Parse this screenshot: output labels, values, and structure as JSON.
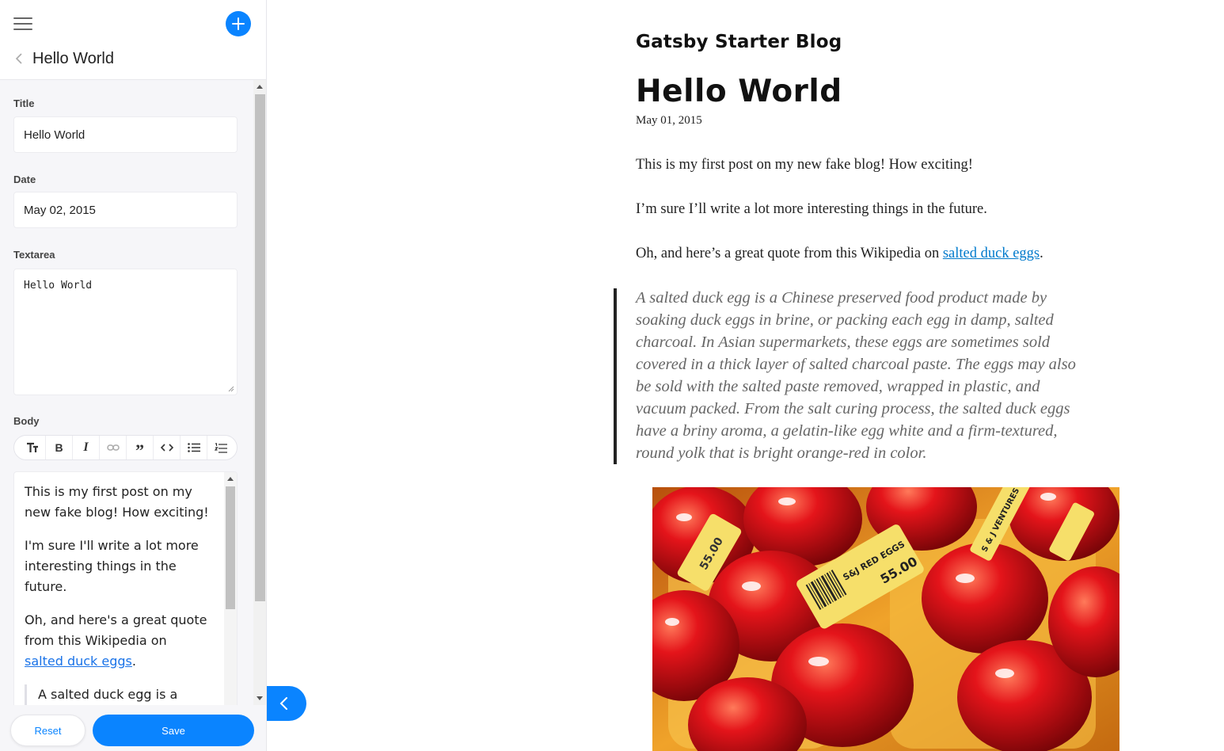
{
  "sidebar": {
    "doc_title": "Hello World",
    "fields": {
      "title_label": "Title",
      "title_value": "Hello World",
      "date_label": "Date",
      "date_value": "May 02, 2015",
      "textarea_label": "Textarea",
      "textarea_value": "Hello World",
      "body_label": "Body"
    },
    "toolbar_icons": [
      "text-size-icon",
      "bold-icon",
      "italic-icon",
      "link-icon",
      "quote-icon",
      "code-icon",
      "bullet-list-icon",
      "numbered-list-icon"
    ],
    "body": {
      "p1": "This is my first post on my new fake blog! How exciting!",
      "p2": "I'm sure I'll write a lot more interesting things in the future.",
      "p3_prefix": "Oh, and here's a great quote from this Wikipedia on",
      "p3_link": "salted duck eggs",
      "p3_suffix": ".",
      "quote_start": "A salted duck egg is a Chinese preserved food"
    },
    "footer": {
      "reset_label": "Reset",
      "save_label": "Save"
    }
  },
  "preview": {
    "site_title": "Gatsby Starter Blog",
    "post_title": "Hello World",
    "post_date": "May 01, 2015",
    "p1": "This is my first post on my new fake blog! How exciting!",
    "p2": "I’m sure I’ll write a lot more interesting things in the future.",
    "p3_prefix": "Oh, and here’s a great quote from this Wikipedia on ",
    "p3_link": "salted duck eggs",
    "p3_suffix": ".",
    "quote_lines": [
      "A salted duck egg is a Chinese preserved food product made by",
      "soaking duck eggs in brine, or packing each egg in damp, salted",
      "charcoal. In Asian supermarkets, these eggs are sometimes sold",
      "covered in a thick layer of salted charcoal paste. The eggs may also",
      "be sold with the salted paste removed, wrapped in plastic, and",
      "vacuum packed. From the salt curing process, the salted duck eggs",
      "have a briny aroma, a gelatin-like egg white and a firm-textured,",
      "round yolk that is bright orange-red in color."
    ],
    "photo": {
      "label_1": "S&J RED EGGS",
      "label_2": "55.00",
      "label_3": "S & J VENTURES"
    }
  },
  "colors": {
    "accent": "#0a84ff",
    "link": "#007acc"
  }
}
